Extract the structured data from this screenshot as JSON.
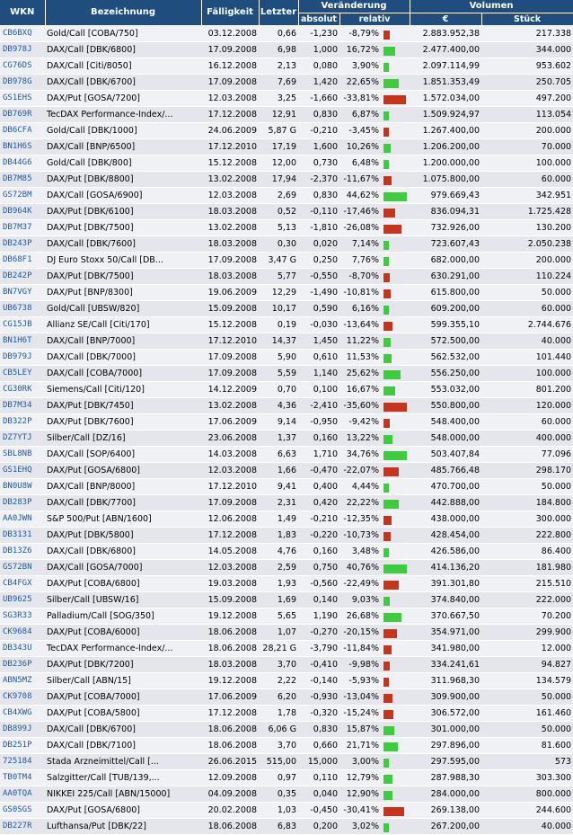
{
  "headers": {
    "wkn": "WKN",
    "bezeichnung": "Bezeichnung",
    "faelligkeit": "Fälligkeit",
    "letzter": "Letzter",
    "veraenderung": "Veränderung",
    "absolut": "absolut",
    "relativ": "relativ",
    "volumen": "Volumen",
    "euro": "€",
    "stueck": "Stück"
  },
  "colors": {
    "header_bg": "#1e4d7e",
    "negative": "#c8331c",
    "positive": "#3dcc3d",
    "wkn_link": "#1f58a6"
  },
  "rows": [
    {
      "wkn": "CB6BXQ",
      "name": "Gold/Call [COBA/750]",
      "date": "03.12.2008",
      "last": "0,66",
      "abs": "-1,230",
      "rel": "-8,79%",
      "rel_value": -8.79,
      "eur": "2.883.952,38",
      "pcs": "217.338"
    },
    {
      "wkn": "DB978J",
      "name": "DAX/Call [DBK/6800]",
      "date": "17.09.2008",
      "last": "6,98",
      "abs": "1,000",
      "rel": "16,72%",
      "rel_value": 16.72,
      "eur": "2.477.400,00",
      "pcs": "344.000"
    },
    {
      "wkn": "CG76DS",
      "name": "DAX/Call [Citi/8050]",
      "date": "16.12.2008",
      "last": "2,13",
      "abs": "0,080",
      "rel": "3,90%",
      "rel_value": 3.9,
      "eur": "2.097.114,99",
      "pcs": "953.602"
    },
    {
      "wkn": "DB978G",
      "name": "DAX/Call [DBK/6700]",
      "date": "17.09.2008",
      "last": "7,69",
      "abs": "1,420",
      "rel": "22,65%",
      "rel_value": 22.65,
      "eur": "1.851.353,49",
      "pcs": "250.705"
    },
    {
      "wkn": "GS1EHS",
      "name": "DAX/Put [GOSA/7200]",
      "date": "12.03.2008",
      "last": "3,25",
      "abs": "-1,660",
      "rel": "-33,81%",
      "rel_value": -33.81,
      "eur": "1.572.034,00",
      "pcs": "497.200"
    },
    {
      "wkn": "DB769R",
      "name": "TecDAX Performance-Index/...",
      "date": "17.12.2008",
      "last": "12,91",
      "abs": "0,830",
      "rel": "6,87%",
      "rel_value": 6.87,
      "eur": "1.509.924,97",
      "pcs": "113.054"
    },
    {
      "wkn": "DB6CFA",
      "name": "Gold/Call [DBK/1000]",
      "date": "24.06.2009",
      "last": "5,87 G",
      "abs": "-0,210",
      "rel": "-3,45%",
      "rel_value": -3.45,
      "eur": "1.267.400,00",
      "pcs": "200.000"
    },
    {
      "wkn": "BN1H6S",
      "name": "DAX/Call [BNP/6500]",
      "date": "17.12.2010",
      "last": "17,19",
      "abs": "1,600",
      "rel": "10,26%",
      "rel_value": 10.26,
      "eur": "1.206.200,00",
      "pcs": "70.000"
    },
    {
      "wkn": "DB44G6",
      "name": "Gold/Call [DBK/800]",
      "date": "15.12.2008",
      "last": "12,00",
      "abs": "0,730",
      "rel": "6,48%",
      "rel_value": 6.48,
      "eur": "1.200.000,00",
      "pcs": "100.000"
    },
    {
      "wkn": "DB7M85",
      "name": "DAX/Put [DBK/8800]",
      "date": "13.02.2008",
      "last": "17,94",
      "abs": "-2,370",
      "rel": "-11,67%",
      "rel_value": -11.67,
      "eur": "1.075.800,00",
      "pcs": "60.000"
    },
    {
      "wkn": "GS72BM",
      "name": "DAX/Call [GOSA/6900]",
      "date": "12.03.2008",
      "last": "2,69",
      "abs": "0,830",
      "rel": "44,62%",
      "rel_value": 44.62,
      "eur": "979.669,43",
      "pcs": "342.951"
    },
    {
      "wkn": "DB964K",
      "name": "DAX/Put [DBK/6100]",
      "date": "18.03.2008",
      "last": "0,52",
      "abs": "-0,110",
      "rel": "-17,46%",
      "rel_value": -17.46,
      "eur": "836.094,31",
      "pcs": "1.725.428"
    },
    {
      "wkn": "DB7M37",
      "name": "DAX/Put [DBK/7500]",
      "date": "13.02.2008",
      "last": "5,13",
      "abs": "-1,810",
      "rel": "-26,08%",
      "rel_value": -26.08,
      "eur": "732.926,00",
      "pcs": "130.200"
    },
    {
      "wkn": "DB243P",
      "name": "DAX/Call [DBK/7600]",
      "date": "18.03.2008",
      "last": "0,30",
      "abs": "0,020",
      "rel": "7,14%",
      "rel_value": 7.14,
      "eur": "723.607,43",
      "pcs": "2.050.238"
    },
    {
      "wkn": "DB68F1",
      "name": "DJ Euro Stoxx 50/Call [DB...",
      "date": "17.09.2008",
      "last": "3,47 G",
      "abs": "0,250",
      "rel": "7,76%",
      "rel_value": 7.76,
      "eur": "682.000,00",
      "pcs": "200.000"
    },
    {
      "wkn": "DB242P",
      "name": "DAX/Put [DBK/7500]",
      "date": "18.03.2008",
      "last": "5,77",
      "abs": "-0,550",
      "rel": "-8,70%",
      "rel_value": -8.7,
      "eur": "630.291,00",
      "pcs": "110.224"
    },
    {
      "wkn": "BN7VGY",
      "name": "DAX/Put [BNP/8300]",
      "date": "19.06.2009",
      "last": "12,29",
      "abs": "-1,490",
      "rel": "-10,81%",
      "rel_value": -10.81,
      "eur": "615.800,00",
      "pcs": "50.000"
    },
    {
      "wkn": "UB6738",
      "name": "Gold/Call [UBSW/820]",
      "date": "15.09.2008",
      "last": "10,17",
      "abs": "0,590",
      "rel": "6,16%",
      "rel_value": 6.16,
      "eur": "609.200,00",
      "pcs": "60.000"
    },
    {
      "wkn": "CG15JB",
      "name": "Allianz SE/Call [Citi/170]",
      "date": "15.12.2008",
      "last": "0,19",
      "abs": "-0,030",
      "rel": "-13,64%",
      "rel_value": -13.64,
      "eur": "599.355,10",
      "pcs": "2.744.676"
    },
    {
      "wkn": "BN1H6T",
      "name": "DAX/Call [BNP/7000]",
      "date": "17.12.2010",
      "last": "14,37",
      "abs": "1,450",
      "rel": "11,22%",
      "rel_value": 11.22,
      "eur": "572.500,00",
      "pcs": "40.000"
    },
    {
      "wkn": "DB979J",
      "name": "DAX/Call [DBK/7000]",
      "date": "17.09.2008",
      "last": "5,90",
      "abs": "0,610",
      "rel": "11,53%",
      "rel_value": 11.53,
      "eur": "562.532,00",
      "pcs": "101.440"
    },
    {
      "wkn": "CB5LEY",
      "name": "DAX/Call [COBA/7000]",
      "date": "17.09.2008",
      "last": "5,59",
      "abs": "1,140",
      "rel": "25,62%",
      "rel_value": 25.62,
      "eur": "556.250,00",
      "pcs": "100.000"
    },
    {
      "wkn": "CG30RK",
      "name": "Siemens/Call [Citi/120]",
      "date": "14.12.2009",
      "last": "0,70",
      "abs": "0,100",
      "rel": "16,67%",
      "rel_value": 16.67,
      "eur": "553.032,00",
      "pcs": "801.200"
    },
    {
      "wkn": "DB7M34",
      "name": "DAX/Put [DBK/7450]",
      "date": "13.02.2008",
      "last": "4,36",
      "abs": "-2,410",
      "rel": "-35,60%",
      "rel_value": -35.6,
      "eur": "550.800,00",
      "pcs": "120.000"
    },
    {
      "wkn": "DB322P",
      "name": "DAX/Put [DBK/7600]",
      "date": "17.06.2009",
      "last": "9,14",
      "abs": "-0,950",
      "rel": "-9,42%",
      "rel_value": -9.42,
      "eur": "548.400,00",
      "pcs": "60.000"
    },
    {
      "wkn": "DZ7YTJ",
      "name": "Silber/Call [DZ/16]",
      "date": "23.06.2008",
      "last": "1,37",
      "abs": "0,160",
      "rel": "13,22%",
      "rel_value": 13.22,
      "eur": "548.000,00",
      "pcs": "400.000"
    },
    {
      "wkn": "SBL8NB",
      "name": "DAX/Call [SOP/6400]",
      "date": "14.03.2008",
      "last": "6,63",
      "abs": "1,710",
      "rel": "34,76%",
      "rel_value": 34.76,
      "eur": "503.407,84",
      "pcs": "77.096"
    },
    {
      "wkn": "GS1EHQ",
      "name": "DAX/Put [GOSA/6800]",
      "date": "12.03.2008",
      "last": "1,66",
      "abs": "-0,470",
      "rel": "-22,07%",
      "rel_value": -22.07,
      "eur": "485.766,48",
      "pcs": "298.170"
    },
    {
      "wkn": "BN0U8W",
      "name": "DAX/Call [BNP/8000]",
      "date": "17.12.2010",
      "last": "9,41",
      "abs": "0,400",
      "rel": "4,44%",
      "rel_value": 4.44,
      "eur": "470.700,00",
      "pcs": "50.000"
    },
    {
      "wkn": "DB283P",
      "name": "DAX/Call [DBK/7700]",
      "date": "17.09.2008",
      "last": "2,31",
      "abs": "0,420",
      "rel": "22,22%",
      "rel_value": 22.22,
      "eur": "442.888,00",
      "pcs": "184.800"
    },
    {
      "wkn": "AA0JWN",
      "name": "S&P 500/Put [ABN/1600]",
      "date": "12.06.2008",
      "last": "1,49",
      "abs": "-0,210",
      "rel": "-12,35%",
      "rel_value": -12.35,
      "eur": "438.000,00",
      "pcs": "300.000"
    },
    {
      "wkn": "DB3131",
      "name": "DAX/Put [DBK/5800]",
      "date": "17.12.2008",
      "last": "1,83",
      "abs": "-0,220",
      "rel": "-10,73%",
      "rel_value": -10.73,
      "eur": "428.454,00",
      "pcs": "222.800"
    },
    {
      "wkn": "DB13Z6",
      "name": "DAX/Call [DBK/6800]",
      "date": "14.05.2008",
      "last": "4,76",
      "abs": "0,160",
      "rel": "3,48%",
      "rel_value": 3.48,
      "eur": "426.586,00",
      "pcs": "86.400"
    },
    {
      "wkn": "GS72BN",
      "name": "DAX/Call [GOSA/7000]",
      "date": "12.03.2008",
      "last": "2,59",
      "abs": "0,750",
      "rel": "40,76%",
      "rel_value": 40.76,
      "eur": "414.136,20",
      "pcs": "181.980"
    },
    {
      "wkn": "CB4FGX",
      "name": "DAX/Put [COBA/6800]",
      "date": "19.03.2008",
      "last": "1,93",
      "abs": "-0,560",
      "rel": "-22,49%",
      "rel_value": -22.49,
      "eur": "391.301,80",
      "pcs": "215.510"
    },
    {
      "wkn": "UB9625",
      "name": "Silber/Call [UBSW/16]",
      "date": "15.09.2008",
      "last": "1,69",
      "abs": "0,140",
      "rel": "9,03%",
      "rel_value": 9.03,
      "eur": "374.840,00",
      "pcs": "222.000"
    },
    {
      "wkn": "SG3R33",
      "name": "Palladium/Call [SOG/350]",
      "date": "19.12.2008",
      "last": "5,65",
      "abs": "1,190",
      "rel": "26,68%",
      "rel_value": 26.68,
      "eur": "370.667,50",
      "pcs": "70.200"
    },
    {
      "wkn": "CK9684",
      "name": "DAX/Put [COBA/6000]",
      "date": "18.06.2008",
      "last": "1,07",
      "abs": "-0,270",
      "rel": "-20,15%",
      "rel_value": -20.15,
      "eur": "354.971,00",
      "pcs": "299.900"
    },
    {
      "wkn": "DB343U",
      "name": "TecDAX Performance-Index/...",
      "date": "18.06.2008",
      "last": "28,21 G",
      "abs": "-3,790",
      "rel": "-11,84%",
      "rel_value": -11.84,
      "eur": "341.980,00",
      "pcs": "12.000"
    },
    {
      "wkn": "DB236P",
      "name": "DAX/Put [DBK/7200]",
      "date": "18.03.2008",
      "last": "3,70",
      "abs": "-0,410",
      "rel": "-9,98%",
      "rel_value": -9.98,
      "eur": "334.241,61",
      "pcs": "94.827"
    },
    {
      "wkn": "ABN5MZ",
      "name": "Silber/Call [ABN/15]",
      "date": "19.12.2008",
      "last": "2,22",
      "abs": "-0,140",
      "rel": "-5,93%",
      "rel_value": -5.93,
      "eur": "311.968,30",
      "pcs": "134.579"
    },
    {
      "wkn": "CK9708",
      "name": "DAX/Put [COBA/7000]",
      "date": "17.06.2009",
      "last": "6,20",
      "abs": "-0,930",
      "rel": "-13,04%",
      "rel_value": -13.04,
      "eur": "309.900,00",
      "pcs": "50.000"
    },
    {
      "wkn": "CB4XWG",
      "name": "DAX/Put [COBA/5800]",
      "date": "17.12.2008",
      "last": "1,78",
      "abs": "-0,320",
      "rel": "-15,24%",
      "rel_value": -15.24,
      "eur": "306.572,00",
      "pcs": "161.460"
    },
    {
      "wkn": "DB899J",
      "name": "DAX/Call [DBK/6700]",
      "date": "18.06.2008",
      "last": "6,06 G",
      "abs": "0,830",
      "rel": "15,87%",
      "rel_value": 15.87,
      "eur": "301.000,00",
      "pcs": "50.000"
    },
    {
      "wkn": "DB251P",
      "name": "DAX/Call [DBK/7100]",
      "date": "18.06.2008",
      "last": "3,70",
      "abs": "0,660",
      "rel": "21,71%",
      "rel_value": 21.71,
      "eur": "297.896,00",
      "pcs": "81.600"
    },
    {
      "wkn": "725184",
      "name": "Stada Arzneimittel/Call [...",
      "date": "26.06.2015",
      "last": "515,00",
      "abs": "15,000",
      "rel": "3,00%",
      "rel_value": 3.0,
      "eur": "297.595,00",
      "pcs": "573"
    },
    {
      "wkn": "TB0TM4",
      "name": "Salzgitter/Call [TUB/139,...",
      "date": "12.09.2008",
      "last": "0,97",
      "abs": "0,110",
      "rel": "12,79%",
      "rel_value": 12.79,
      "eur": "287.988,30",
      "pcs": "303.300"
    },
    {
      "wkn": "AA0TQA",
      "name": "NIKKEI 225/Call [ABN/15000]",
      "date": "04.09.2008",
      "last": "0,35",
      "abs": "0,040",
      "rel": "12,90%",
      "rel_value": 12.9,
      "eur": "284.000,00",
      "pcs": "800.000"
    },
    {
      "wkn": "GS0SGS",
      "name": "DAX/Put [GOSA/6800]",
      "date": "20.02.2008",
      "last": "1,03",
      "abs": "-0,450",
      "rel": "-30,41%",
      "rel_value": -30.41,
      "eur": "269.138,00",
      "pcs": "244.600"
    },
    {
      "wkn": "DB227R",
      "name": "Lufthansa/Put [DBK/22]",
      "date": "18.06.2008",
      "last": "6,83",
      "abs": "0,200",
      "rel": "3,02%",
      "rel_value": 3.02,
      "eur": "267.200,00",
      "pcs": "40.000"
    }
  ]
}
